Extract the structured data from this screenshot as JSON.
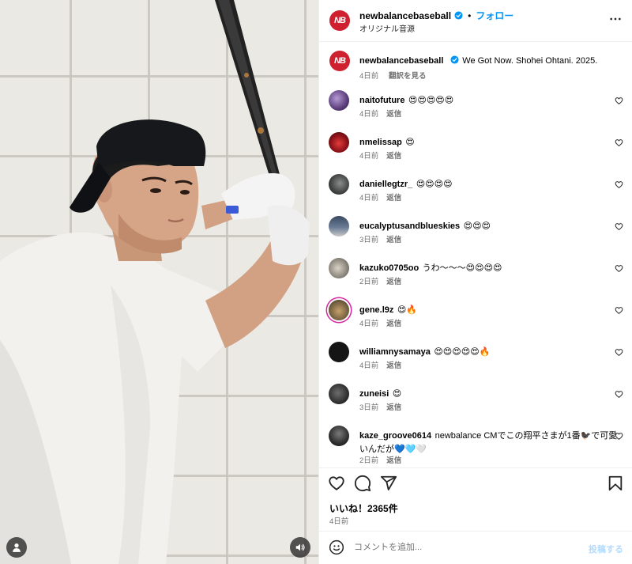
{
  "account": {
    "username": "newbalancebaseball",
    "logo_text": "NB",
    "audio_label": "オリジナル音源",
    "follow_label": "フォロー",
    "separator": "•"
  },
  "caption": {
    "text": "We Got Now. Shohei Ohtani. 2025.",
    "time": "4日前",
    "translate": "翻訳を見る"
  },
  "comments": [
    {
      "user": "naitofuture",
      "text": "😍😍😍😍😍",
      "time": "4日前",
      "reply": "返信"
    },
    {
      "user": "nmelissap",
      "text": "😍",
      "time": "4日前",
      "reply": "返信"
    },
    {
      "user": "daniellegtzr_",
      "text": "😍😍😍😍",
      "time": "4日前",
      "reply": "返信"
    },
    {
      "user": "eucalyptusandblueskies",
      "text": "😍😍😍",
      "time": "3日前",
      "reply": "返信"
    },
    {
      "user": "kazuko0705oo",
      "text": "うわ〜〜〜😍😍😍😍",
      "time": "2日前",
      "reply": "返信"
    },
    {
      "user": "gene.l9z",
      "text": "😍🔥",
      "time": "4日前",
      "reply": "返信"
    },
    {
      "user": "williamnysamaya",
      "text": "😍😍😍😍😍🔥",
      "time": "4日前",
      "reply": "返信"
    },
    {
      "user": "zuneisi",
      "text": "😍",
      "time": "3日前",
      "reply": "返信"
    },
    {
      "user": "kaze_groove0614",
      "text": "newbalance CMでこの翔平さまが1番🐦‍⬛で可愛いんだが💙🩵🤍",
      "time": "2日前",
      "reply": "返信"
    }
  ],
  "post": {
    "likes": "いいね！2365件",
    "date": "4日前"
  },
  "composer": {
    "placeholder": "コメントを追加...",
    "post_label": "投稿する"
  },
  "colors": {
    "accent": "#0095f6",
    "brand": "#cf202f",
    "muted": "#737373"
  }
}
